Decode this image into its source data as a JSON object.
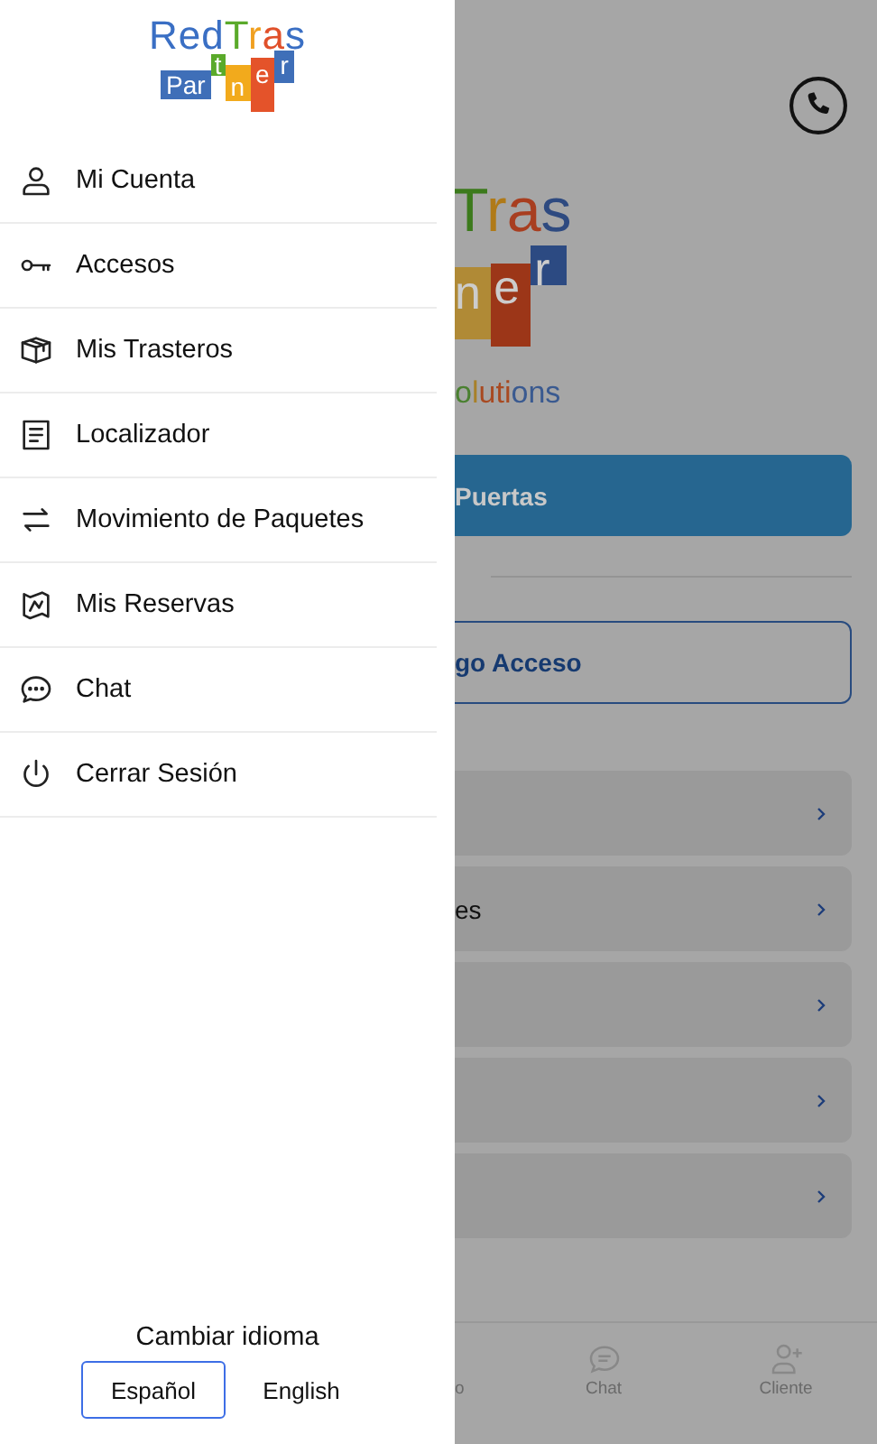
{
  "drawer": {
    "logo": {
      "line1": [
        {
          "text": "Red",
          "color": "#3a6fc4"
        },
        {
          "text": "T",
          "color": "#5aaa2a"
        },
        {
          "text": "r",
          "color": "#f0a020"
        },
        {
          "text": "a",
          "color": "#e0502a"
        },
        {
          "text": "s",
          "color": "#3a6fc4"
        }
      ],
      "line2": [
        {
          "text": "Par",
          "color": "#3f6fb8"
        },
        {
          "text": "t",
          "color": "#5aaa2a"
        },
        {
          "text": "n",
          "color": "#f2aa1c"
        },
        {
          "text": "e",
          "color": "#e4532a"
        },
        {
          "text": "r",
          "color": "#3f6fb8"
        }
      ]
    },
    "menu": [
      {
        "label": "Mi Cuenta",
        "kind": "person"
      },
      {
        "label": "Accesos",
        "kind": "key"
      },
      {
        "label": "Mis Trasteros",
        "kind": "box"
      },
      {
        "label": "Localizador",
        "kind": "document"
      },
      {
        "label": "Movimiento de Paquetes",
        "kind": "transfer"
      },
      {
        "label": "Mis Reservas",
        "kind": "reservation"
      },
      {
        "label": "Chat",
        "kind": "chat"
      },
      {
        "label": "Cerrar Sesión",
        "kind": "power"
      }
    ],
    "language": {
      "title": "Cambiar idioma",
      "options": [
        {
          "label": "Español",
          "selected": true
        },
        {
          "label": "English",
          "selected": false
        }
      ]
    }
  },
  "background": {
    "logo": {
      "line1": [
        {
          "text": "T",
          "color": "#3c7a1c"
        },
        {
          "text": "r",
          "color": "#b07a18"
        },
        {
          "text": "a",
          "color": "#a83e20"
        },
        {
          "text": "s",
          "color": "#2e4a80"
        }
      ],
      "line2": [
        {
          "text": "n",
          "color": "#b08a36"
        },
        {
          "text": "e",
          "color": "#9c3618"
        },
        {
          "text": "r",
          "color": "#2c4a82"
        }
      ],
      "tagline": [
        {
          "text": "o",
          "color": "#4a8030"
        },
        {
          "text": "l",
          "color": "#a88028"
        },
        {
          "text": "u",
          "color": "#a84a22"
        },
        {
          "text": "t",
          "color": "#a84a22"
        },
        {
          "text": "i",
          "color": "#a84a22"
        },
        {
          "text": "ons",
          "color": "#3a5a90"
        }
      ]
    },
    "primary_button": "Puertas",
    "secondary_button": "go Acceso",
    "cards": [
      {
        "kind": "blank"
      },
      {
        "kind": "text",
        "label": "es"
      },
      {
        "kind": "blank"
      },
      {
        "kind": "blank"
      },
      {
        "kind": "blank"
      }
    ],
    "tabs": [
      {
        "label": "o",
        "kind": "none"
      },
      {
        "label": "Chat",
        "kind": "chat"
      },
      {
        "label": "Cliente",
        "kind": "add-person"
      }
    ]
  }
}
